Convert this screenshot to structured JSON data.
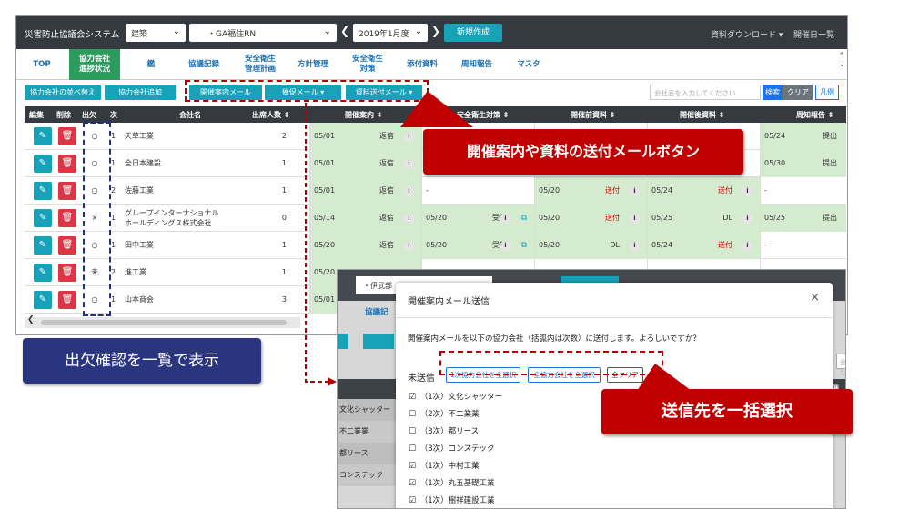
{
  "app": {
    "title": "災害防止協議会システム",
    "category_select": "建築",
    "site_select": "・GA福住RN",
    "period_select": "2019年1月度",
    "new_button": "新規作成",
    "download_link": "資料ダウンロード",
    "schedule_link": "開催日一覧",
    "prev_icon": "chevron-left-icon",
    "next_icon": "chevron-right-icon"
  },
  "tabs": [
    {
      "label": "TOP"
    },
    {
      "label": "協力会社\n進捗状況",
      "active": true
    },
    {
      "label": "鑑"
    },
    {
      "label": "協議記録"
    },
    {
      "label": "安全衛生\n管理計画"
    },
    {
      "label": "方針管理"
    },
    {
      "label": "安全衛生\n対策"
    },
    {
      "label": "添付資料"
    },
    {
      "label": "周知報告"
    },
    {
      "label": "マスタ"
    }
  ],
  "toolbar": {
    "sort_button": "協力会社の並べ替え",
    "add_button": "協力会社追加",
    "notice_mail": "開催案内メール",
    "reminder_mail": "催促メール ▾",
    "material_mail": "資料送付メール ▾",
    "search_placeholder": "会社名を入力してください",
    "search_button": "検索",
    "clear_button": "クリア",
    "legend_button": "凡例"
  },
  "table": {
    "headers": {
      "edit": "編集",
      "delete": "削除",
      "attendance": "出欠",
      "tier": "次",
      "company": "会社名",
      "attendees": "出席人数 ⇕",
      "notice": "開催案内 ⇕",
      "measures": "安全衛生対策 ⇕",
      "pre": "開催前資料 ⇕",
      "post": "開催後資料 ⇕",
      "report": "周知報告 ⇕"
    },
    "rows": [
      {
        "att": "○",
        "tier": "1",
        "name": "天草工業",
        "count": "2",
        "n_date": "05/01",
        "n_status": "返信",
        "m_date": "",
        "m_status": "",
        "p_date": "",
        "p_status": "",
        "q_date": "",
        "q_status": "",
        "r_date": "05/24",
        "r_status": "提出"
      },
      {
        "att": "○",
        "tier": "1",
        "name": "全日本建設",
        "count": "1",
        "n_date": "05/01",
        "n_status": "返信",
        "m_date": "",
        "m_status": "",
        "p_date": "",
        "p_status": "",
        "q_date": "",
        "q_status": "",
        "r_date": "05/30",
        "r_status": "提出"
      },
      {
        "att": "○",
        "tier": "2",
        "name": "佐藤工業",
        "count": "1",
        "n_date": "05/01",
        "n_status": "返信",
        "m_date": "-",
        "m_status": "",
        "p_date": "05/20",
        "p_status": "送付",
        "q_date": "05/24",
        "q_status": "送付",
        "r_date": "-",
        "r_status": ""
      },
      {
        "att": "×",
        "tier": "1",
        "name": "グループインターナショナル\nホールディングス株式会社",
        "count": "0",
        "n_date": "05/14",
        "n_status": "返信",
        "m_date": "05/20",
        "m_status": "受領",
        "p_date": "05/20",
        "p_status": "送付",
        "q_date": "05/25",
        "q_status": "DL",
        "r_date": "05/25",
        "r_status": "提出"
      },
      {
        "att": "○",
        "tier": "1",
        "name": "田中工業",
        "count": "1",
        "n_date": "05/20",
        "n_status": "返信",
        "m_date": "05/20",
        "m_status": "受領",
        "p_date": "05/20",
        "p_status": "DL",
        "q_date": "05/24",
        "q_status": "送付",
        "r_date": "-",
        "r_status": ""
      },
      {
        "att": "未",
        "tier": "2",
        "name": "進工業",
        "count": "1",
        "n_date": "05/20",
        "n_status": "",
        "m_date": "",
        "m_status": "",
        "p_date": "",
        "p_status": "",
        "q_date": "",
        "q_status": "",
        "r_date": "",
        "r_status": ""
      },
      {
        "att": "○",
        "tier": "1",
        "name": "山本商会",
        "count": "3",
        "n_date": "05/01",
        "n_status": "",
        "m_date": "",
        "m_status": "",
        "p_date": "",
        "p_status": "",
        "q_date": "",
        "q_status": "",
        "r_date": "",
        "r_status": ""
      }
    ]
  },
  "modal": {
    "title": "開催案内メール送信",
    "message": "開催案内メールを以下の協力会社（括弧内は次数）に送付します。よろしいですか？",
    "unsent_label": "未送信",
    "select_first_tier": "1次協力会社を全選択",
    "select_all": "全協力会社を全選択",
    "clear_all": "全クリア",
    "recipients": [
      {
        "label": "（1次）文化シャッター",
        "checked": true
      },
      {
        "label": "（2次）不二業業",
        "checked": false
      },
      {
        "label": "（3次）都リース",
        "checked": false
      },
      {
        "label": "（3次）コンステック",
        "checked": false
      },
      {
        "label": "（1次）中村工業",
        "checked": true
      },
      {
        "label": "（1次）丸五基礎工業",
        "checked": true
      },
      {
        "label": "（1次）樹祥建設工業",
        "checked": true
      }
    ],
    "bg_site": "・伊武部",
    "bg_tab": "協議記",
    "bg_search": "会社名を入力し",
    "bg_col": "開催",
    "bg_rows": [
      "文化シャッター",
      "不二業業",
      "都リース",
      "コンステック"
    ]
  },
  "callouts": {
    "mail_buttons": "開催案内や資料の送付メールボタン",
    "attendance": "出欠確認を一覧で表示",
    "bulk_select": "送信先を一括選択"
  },
  "colors": {
    "accent": "#17a2b8",
    "active_tab": "#2a9d5c",
    "callout_red": "#c00000",
    "callout_navy": "#2a3580",
    "green_cell": "#d4ebd0"
  }
}
